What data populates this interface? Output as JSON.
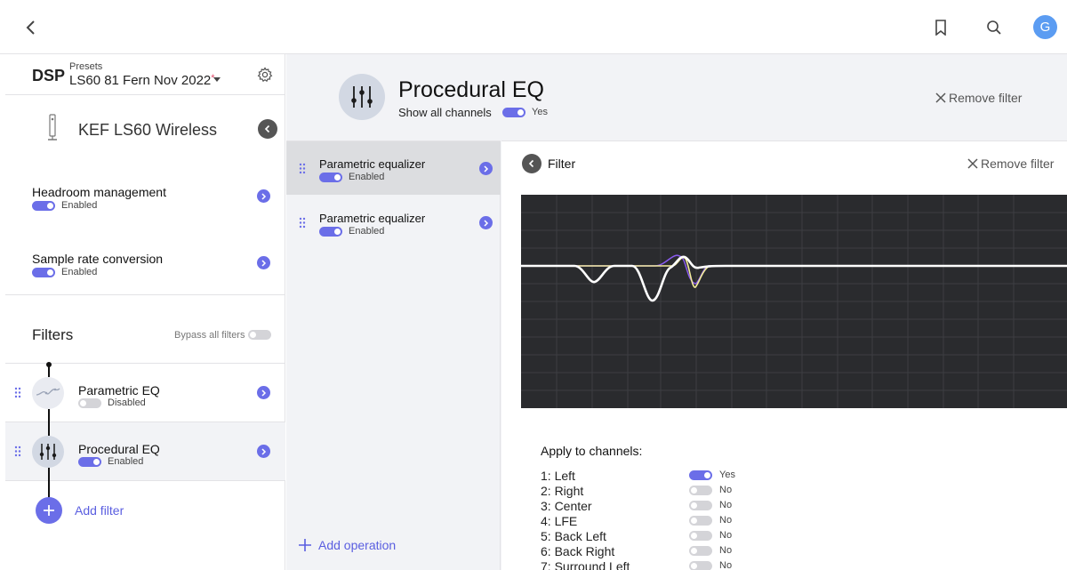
{
  "header": {
    "back_icon": "chevron-left-icon",
    "bookmark_icon": "bookmark-icon",
    "search_icon": "search-icon",
    "avatar_initial": "G"
  },
  "sidebar": {
    "dsp_label": "DSP",
    "presets_label": "Presets",
    "preset_name": "LS60 81 Fern Nov 2022",
    "preset_modified_marker": "*",
    "device_name": "KEF LS60 Wireless",
    "settings": [
      {
        "title": "Headroom management",
        "status": "Enabled",
        "enabled": true
      },
      {
        "title": "Sample rate conversion",
        "status": "Enabled",
        "enabled": true
      }
    ],
    "filters_title": "Filters",
    "bypass_label": "Bypass all filters",
    "bypass_enabled": false,
    "filters": [
      {
        "name": "Parametric EQ",
        "status": "Disabled",
        "enabled": false
      },
      {
        "name": "Procedural EQ",
        "status": "Enabled",
        "enabled": true
      }
    ],
    "add_filter_label": "Add filter"
  },
  "main": {
    "title": "Procedural EQ",
    "show_all_label": "Show all channels",
    "show_all_value": "Yes",
    "remove_filter_label": "Remove filter",
    "operations": [
      {
        "name": "Parametric equalizer",
        "status": "Enabled"
      },
      {
        "name": "Parametric equalizer",
        "status": "Enabled"
      }
    ],
    "add_operation_label": "Add operation",
    "filter_title": "Filter",
    "filter_remove_label": "Remove filter",
    "apply_title": "Apply to channels:",
    "channels": [
      {
        "name": "1: Left",
        "value": "Yes",
        "enabled": true
      },
      {
        "name": "2: Right",
        "value": "No",
        "enabled": false
      },
      {
        "name": "3: Center",
        "value": "No",
        "enabled": false
      },
      {
        "name": "4: LFE",
        "value": "No",
        "enabled": false
      },
      {
        "name": "5: Back Left",
        "value": "No",
        "enabled": false
      },
      {
        "name": "6: Back Right",
        "value": "No",
        "enabled": false
      },
      {
        "name": "7: Surround Left",
        "value": "No",
        "enabled": false
      }
    ]
  },
  "colors": {
    "accent": "#6b6ee8",
    "graph_bg": "#2a2b2e",
    "curve_main": "#ffffff",
    "curve_yellow": "#f2ec9a",
    "curve_purple": "#8a5bf0"
  }
}
